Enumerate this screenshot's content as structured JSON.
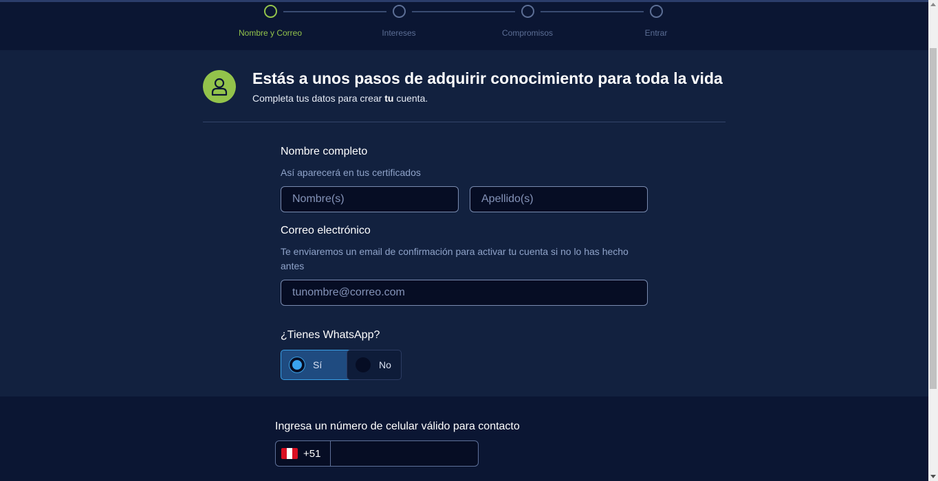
{
  "stepper": {
    "steps": [
      {
        "label": "Nombre y Correo",
        "state": "active"
      },
      {
        "label": "Intereses",
        "state": "pending"
      },
      {
        "label": "Compromisos",
        "state": "pending"
      },
      {
        "label": "Entrar",
        "state": "pending"
      }
    ]
  },
  "header": {
    "title": "Estás a unos pasos de adquirir conocimiento para toda la vida",
    "subtitle_before": "Completa tus datos para crear ",
    "subtitle_bold": "tu",
    "subtitle_after": " cuenta.",
    "avatar_icon": "user-icon"
  },
  "form": {
    "name": {
      "label": "Nombre completo",
      "hint": "Así aparecerá en tus certificados",
      "first_placeholder": "Nombre(s)",
      "last_placeholder": "Apellido(s)"
    },
    "email": {
      "label": "Correo electrónico",
      "hint_line1": "Te enviaremos un email de confirmación para activar tu cuenta si no lo has hecho",
      "hint_line2": "antes",
      "placeholder": "tunombre@correo.com"
    },
    "whatsapp": {
      "label": "¿Tienes WhatsApp?",
      "yes": "Sí",
      "no": "No",
      "selected": "Sí"
    },
    "phone": {
      "label": "Ingresa un número de celular válido para contacto",
      "country_code": "+51",
      "flag_icon": "peru-flag-icon",
      "value": ""
    }
  },
  "colors": {
    "accent": "#93c34b",
    "background": "#12213f",
    "header_bg": "#0b1633",
    "selected_blue": "#3aa3ef"
  }
}
